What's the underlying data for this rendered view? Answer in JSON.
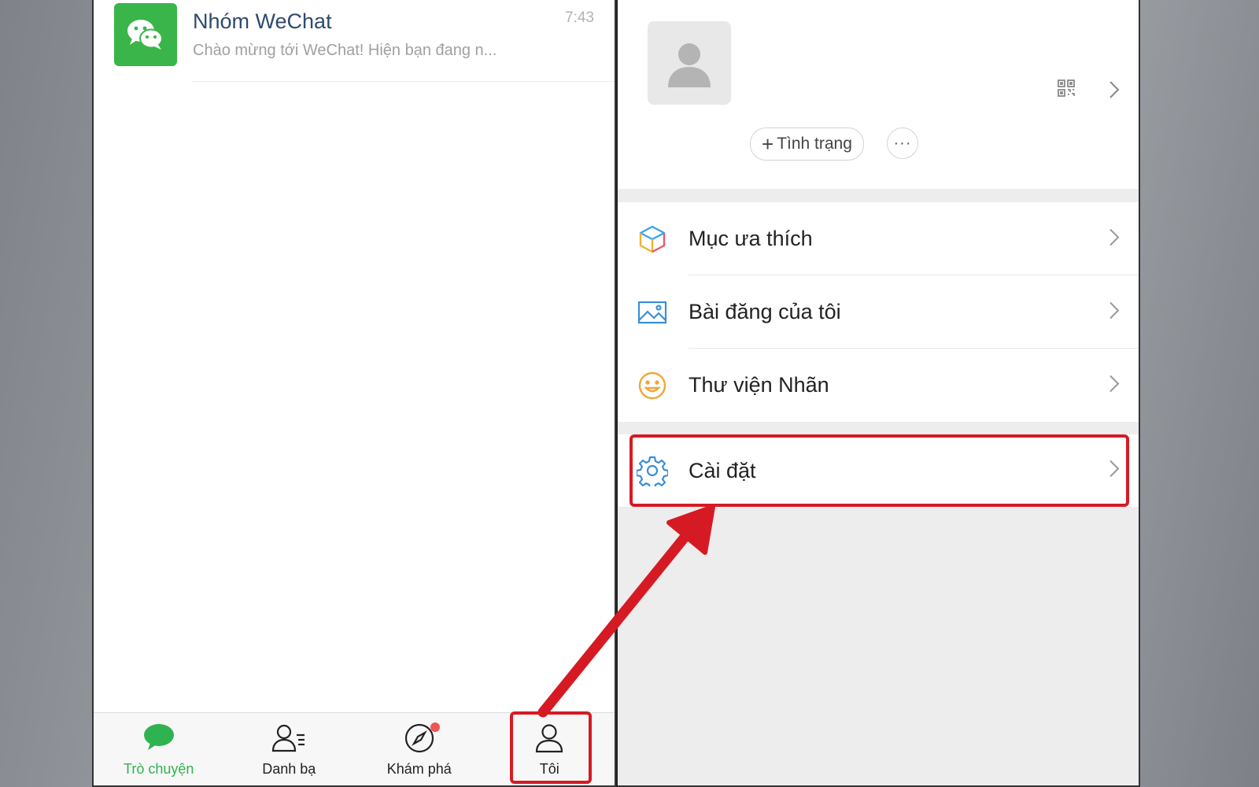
{
  "chat_list": {
    "items": [
      {
        "name": "Nhóm WeChat",
        "time": "7:43",
        "preview": "Chào mừng tới WeChat! Hiện bạn đang n..."
      }
    ]
  },
  "bottom_nav": {
    "items": [
      {
        "label": "Trò chuyện",
        "icon": "chat-bubble-icon",
        "active": true
      },
      {
        "label": "Danh bạ",
        "icon": "contacts-icon",
        "active": false
      },
      {
        "label": "Khám phá",
        "icon": "compass-icon",
        "active": false,
        "badge_dot": true
      },
      {
        "label": "Tôi",
        "icon": "user-icon",
        "active": false,
        "highlighted": true
      }
    ]
  },
  "profile": {
    "status_button": "Tình trạng",
    "more_button": "···"
  },
  "menu": {
    "items": [
      {
        "label": "Mục ưa thích",
        "icon": "cube-icon"
      },
      {
        "label": "Bài đăng của tôi",
        "icon": "image-icon"
      },
      {
        "label": "Thư viện Nhãn",
        "icon": "smiley-icon"
      }
    ],
    "settings": {
      "label": "Cài đặt",
      "icon": "gear-icon",
      "highlighted": true
    }
  },
  "colors": {
    "accent_green": "#2fb350",
    "highlight_red": "#d61a23",
    "wechat_green": "#39b54a"
  }
}
